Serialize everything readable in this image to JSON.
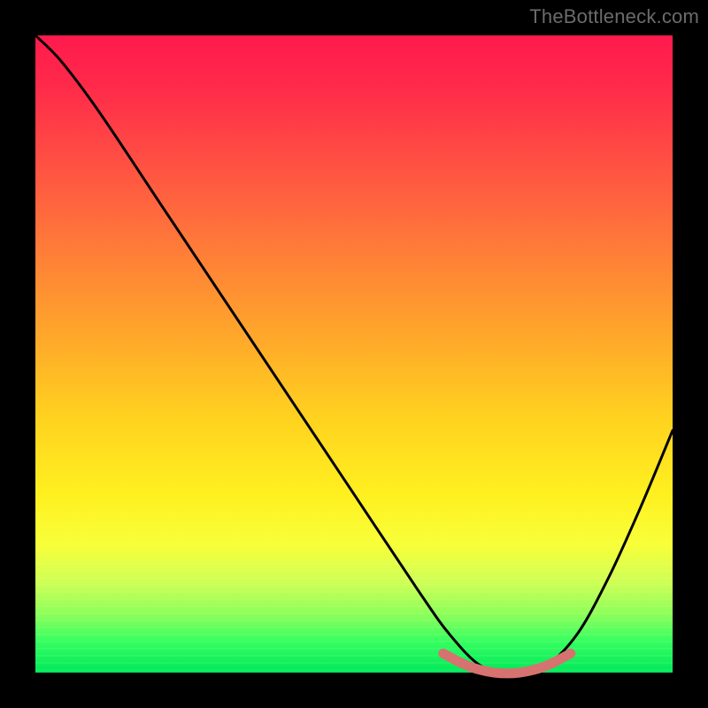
{
  "watermark": "TheBottleneck.com",
  "chart_data": {
    "type": "line",
    "title": "",
    "subtitle": "",
    "xlabel": "",
    "ylabel": "",
    "xlim": [
      0,
      100
    ],
    "ylim": [
      0,
      100
    ],
    "grid": false,
    "legend": false,
    "series": [
      {
        "name": "bottleneck-curve",
        "color": "#000000",
        "x": [
          0,
          4,
          10,
          20,
          30,
          40,
          50,
          60,
          65,
          70,
          75,
          80,
          85,
          90,
          95,
          100
        ],
        "y": [
          100,
          96,
          88,
          73,
          58,
          43,
          28,
          13,
          6,
          1,
          0,
          1,
          6,
          15,
          26,
          38
        ]
      },
      {
        "name": "optimal-band",
        "color": "#d6726f",
        "x": [
          64,
          68,
          72,
          76,
          80,
          84
        ],
        "y": [
          3,
          1,
          0,
          0,
          1,
          3
        ]
      }
    ],
    "annotations": []
  },
  "colors": {
    "frame": "#000000",
    "watermark": "#6b6b6b",
    "curve": "#000000",
    "optimal_band": "#d6726f",
    "gradient_top": "#ff1a4d",
    "gradient_bottom": "#00e85a"
  }
}
